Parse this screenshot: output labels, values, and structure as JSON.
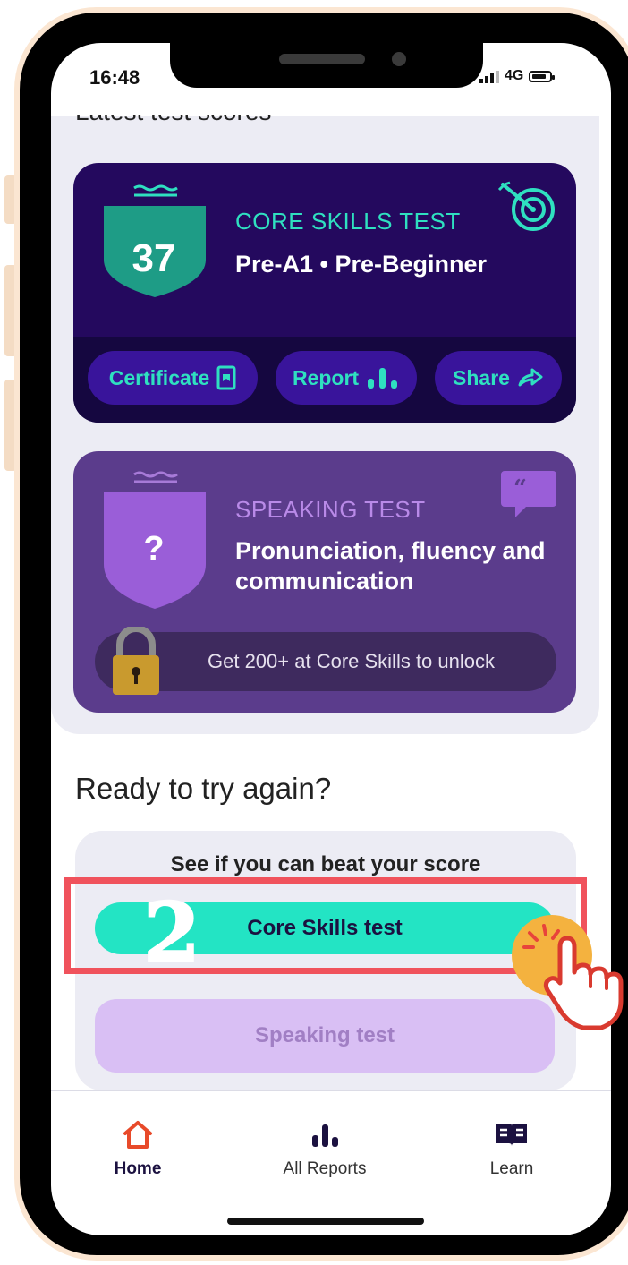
{
  "status_bar": {
    "time": "16:48",
    "network": "4G"
  },
  "section_heading": "Latest test scores",
  "core_card": {
    "score": "37",
    "label": "CORE SKILLS TEST",
    "level": "Pre-A1 • Pre-Beginner",
    "icon": "target-icon",
    "buttons": {
      "certificate": "Certificate",
      "report": "Report",
      "share": "Share"
    }
  },
  "speaking_card": {
    "score": "?",
    "label": "SPEAKING TEST",
    "title": "Pronunciation, fluency and communication",
    "icon": "quote-bubble-icon",
    "lock_text": "Get 200+ at Core Skills to unlock"
  },
  "retry": {
    "heading": "Ready to try again?",
    "subheading": "See if you can beat your score",
    "core_button": "Core Skills test",
    "speaking_button": "Speaking test",
    "step_number": "2"
  },
  "tabs": [
    {
      "label": "Home",
      "icon": "home-icon",
      "active": true
    },
    {
      "label": "All Reports",
      "icon": "bar-chart-icon",
      "active": false
    },
    {
      "label": "Learn",
      "icon": "book-icon",
      "active": false
    }
  ],
  "colors": {
    "core_card_bg": "#24095e",
    "teal_accent": "#2fe0c0",
    "speaking_card_bg": "#5b3c8c",
    "highlight_red": "#f0525c",
    "home_active": "#e84a2a"
  }
}
